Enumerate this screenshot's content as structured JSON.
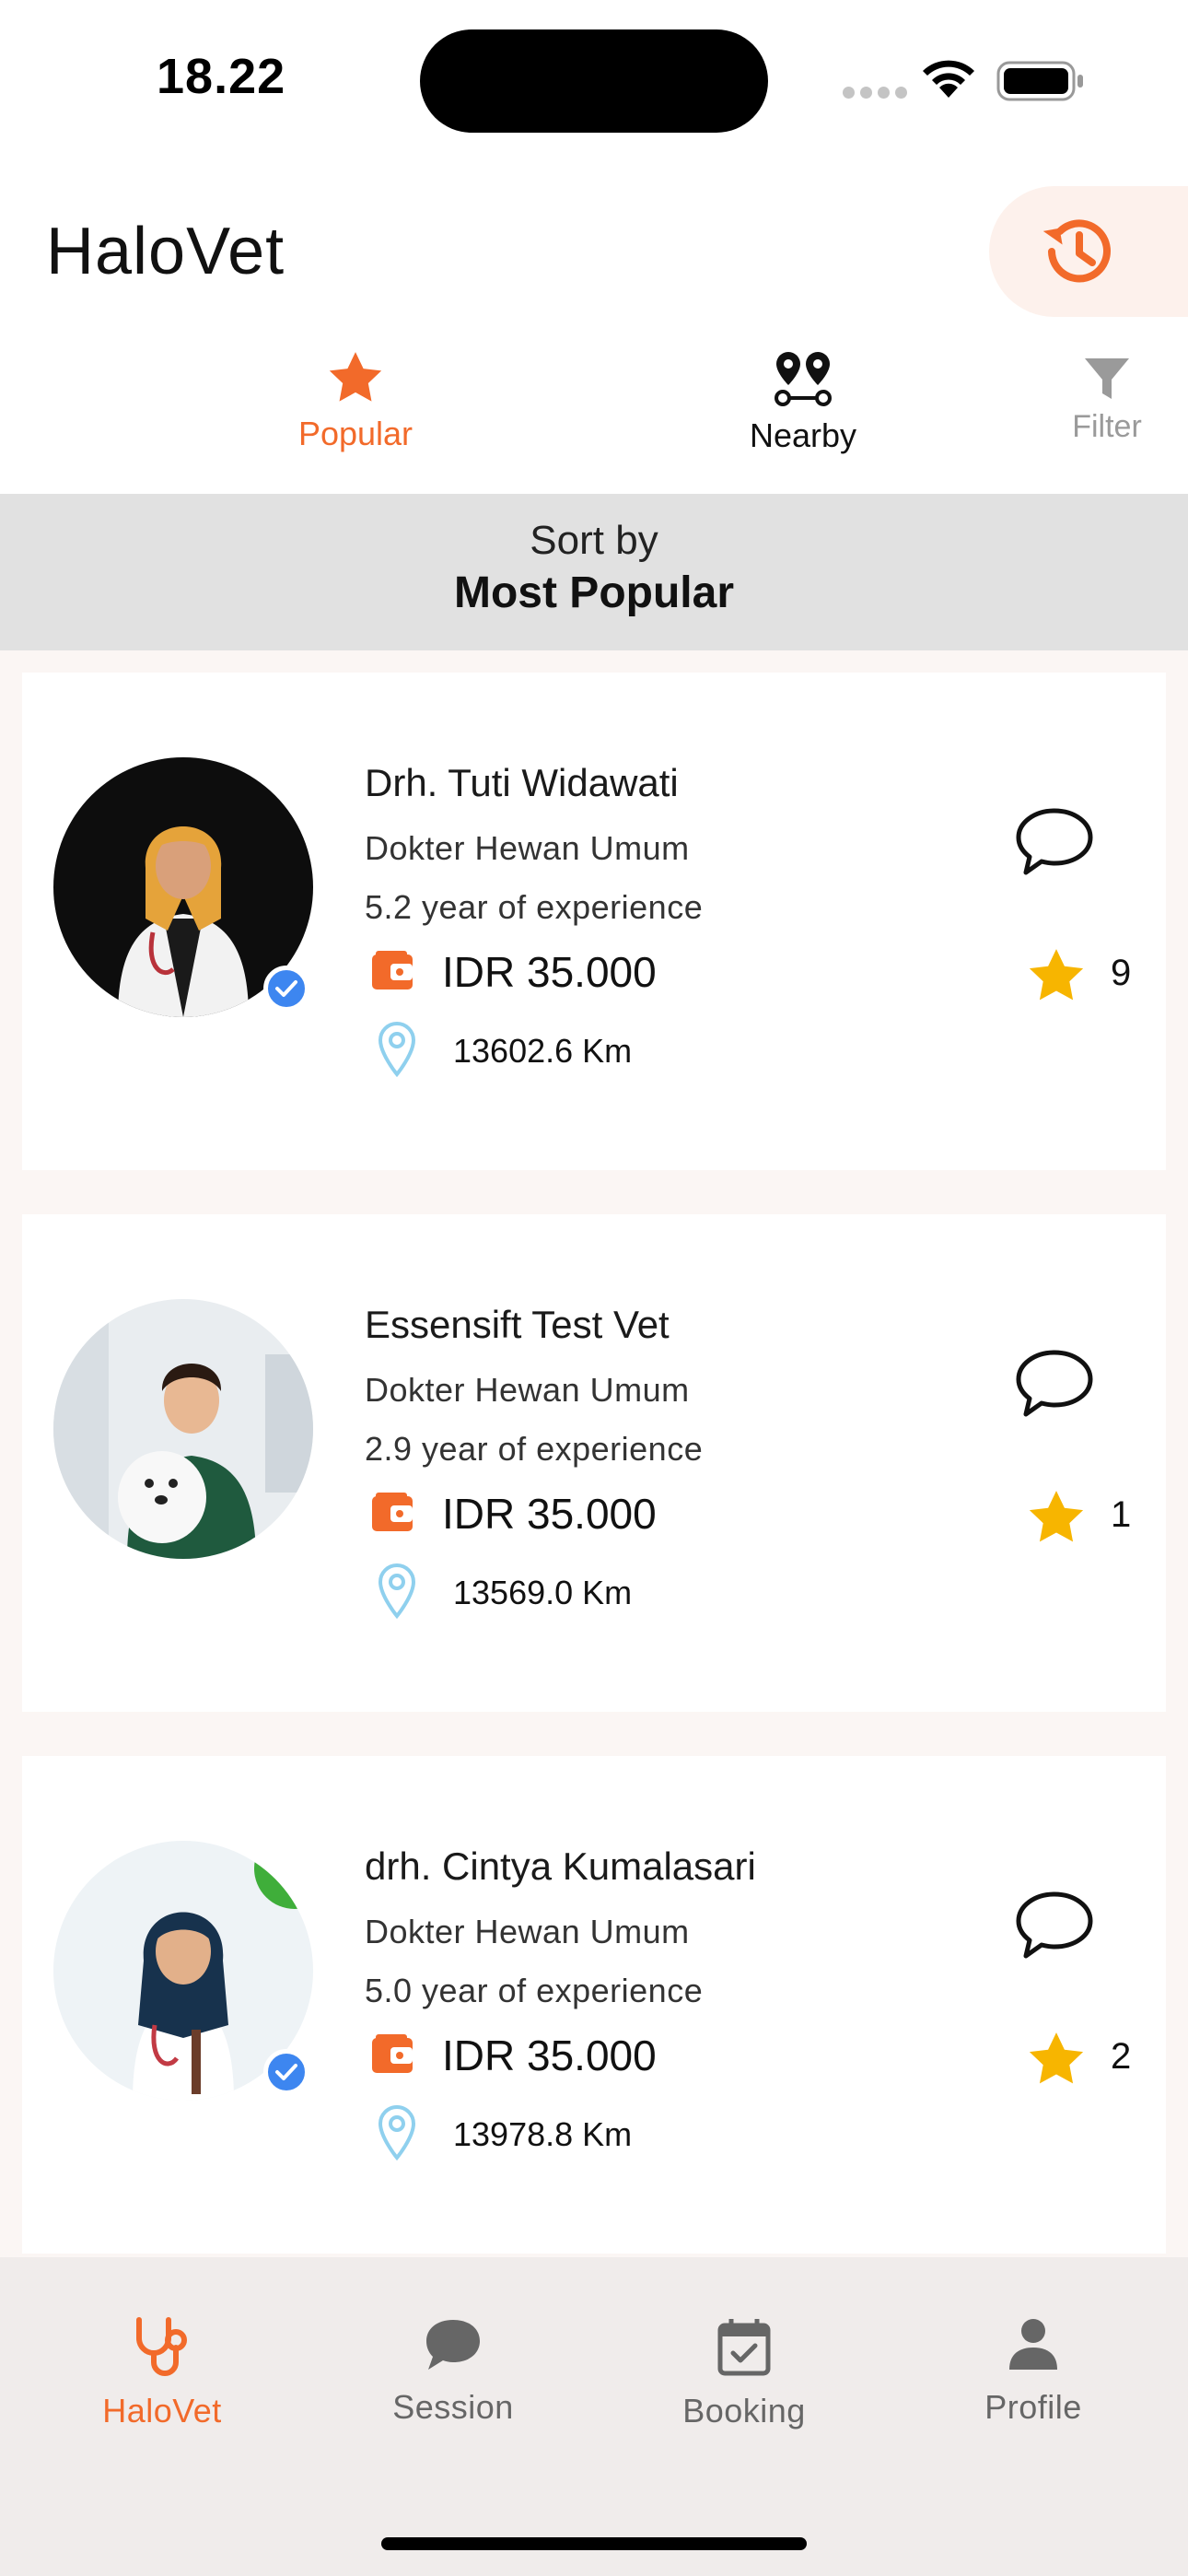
{
  "status_bar": {
    "time": "18.22"
  },
  "header": {
    "title": "HaloVet",
    "history_icon": "history-icon"
  },
  "tabs": [
    {
      "label": "Popular",
      "icon": "star-icon",
      "active": true
    },
    {
      "label": "Nearby",
      "icon": "map-pins-icon",
      "active": false
    },
    {
      "label": "Filter",
      "icon": "filter-icon",
      "active": false
    }
  ],
  "sort": {
    "caption": "Sort by",
    "value": "Most Popular"
  },
  "vets": [
    {
      "name": "Drh. Tuti Widawati",
      "specialty": "Dokter Hewan Umum",
      "experience": "5.2 year of experience",
      "price": "IDR 35.000",
      "distance": "13602.6 Km",
      "rating": "9",
      "verified": true
    },
    {
      "name": "Essensift Test Vet",
      "specialty": "Dokter Hewan Umum",
      "experience": "2.9 year of experience",
      "price": "IDR 35.000",
      "distance": "13569.0 Km",
      "rating": "1",
      "verified": false
    },
    {
      "name": "drh. Cintya Kumalasari",
      "specialty": "Dokter Hewan Umum",
      "experience": "5.0 year of experience",
      "price": "IDR 35.000",
      "distance": "13978.8 Km",
      "rating": "2",
      "verified": true
    }
  ],
  "bottom_nav": [
    {
      "label": "HaloVet",
      "icon": "stethoscope-icon",
      "active": true
    },
    {
      "label": "Session",
      "icon": "chat-bubble-icon",
      "active": false
    },
    {
      "label": "Booking",
      "icon": "calendar-check-icon",
      "active": false
    },
    {
      "label": "Profile",
      "icon": "person-icon",
      "active": false
    }
  ],
  "colors": {
    "accent": "#f26a2a",
    "star": "#f7b500",
    "location": "#8fd0ee",
    "verified": "#3d86f0",
    "sort_bar": "#e1e1e1",
    "nav_background": "#f0eceb"
  }
}
